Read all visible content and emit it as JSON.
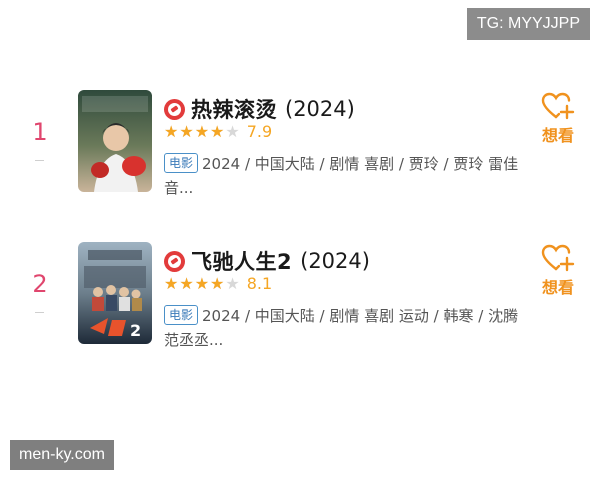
{
  "watermarks": {
    "top": "TG: MYYJJPP",
    "bottom": "men-ky.com"
  },
  "colors": {
    "rank": "#e0466e",
    "star": "#f5a623",
    "want": "#f0921e",
    "tag": "#4a90c8",
    "badge": "#e23b3b"
  },
  "movies": [
    {
      "rank": "1",
      "title": "热辣滚烫",
      "year": "(2024)",
      "rating_fraction": 0.8,
      "score": "7.9",
      "tag": "电影",
      "info": "2024 / 中国大陆 / 剧情 喜剧 / 贾玲 / 贾玲 雷佳音...",
      "want_label": "想看",
      "poster_icon": "movie-poster"
    },
    {
      "rank": "2",
      "title": "飞驰人生2",
      "year": "(2024)",
      "rating_fraction": 0.8,
      "score": "8.1",
      "tag": "电影",
      "info": "2024 / 中国大陆 / 剧情 喜剧 运动 / 韩寒 / 沈腾 范丞丞...",
      "want_label": "想看",
      "poster_icon": "movie-poster"
    }
  ]
}
